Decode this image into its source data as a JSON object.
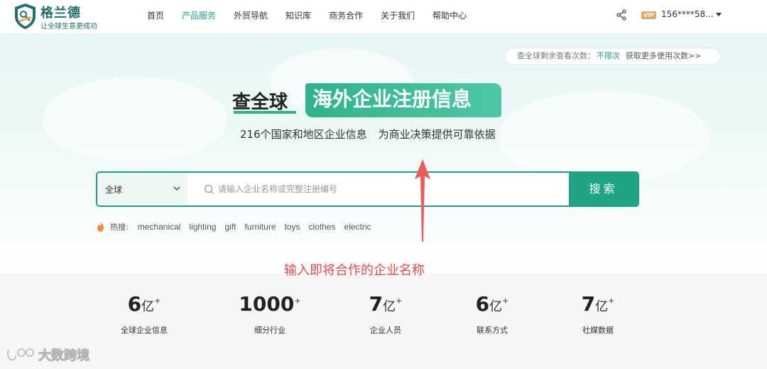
{
  "brand": {
    "name": "格兰德",
    "slogan": "让全球生意更成功",
    "color": "#1f6f70"
  },
  "nav": {
    "items": [
      {
        "label": "首页",
        "active": false
      },
      {
        "label": "产品服务",
        "active": true
      },
      {
        "label": "外贸导航",
        "active": false
      },
      {
        "label": "知识库",
        "active": false
      },
      {
        "label": "商务合作",
        "active": false
      },
      {
        "label": "关于我们",
        "active": false
      },
      {
        "label": "帮助中心",
        "active": false
      }
    ],
    "active_color": "#1aa382"
  },
  "user": {
    "share_icon": "share-icon",
    "vip_label": "VIP",
    "phone": "156****58..."
  },
  "quota": {
    "label": "查全球剩余查看次数：",
    "value": "不限次",
    "link": "获取更多使用次数>>"
  },
  "hero": {
    "headline_left": "查全球",
    "headline_right": "海外企业注册信息",
    "subtitle_part1": "216个国家和地区企业信息",
    "subtitle_part2": "为商业决策提供可靠依据"
  },
  "search": {
    "region": "全球",
    "placeholder": "请输入企业名称或完整注册编号",
    "value": "",
    "button_label": "搜索"
  },
  "hot": {
    "label": "热搜:",
    "items": [
      "mechanical",
      "lighting",
      "gift",
      "furniture",
      "toys",
      "clothes",
      "electric"
    ]
  },
  "annotation": {
    "text": "输入即将合作的企业名称",
    "color": "#e84a4a"
  },
  "stats": [
    {
      "number": "6",
      "unit": "亿",
      "sup": "+",
      "label": "全球企业信息"
    },
    {
      "number": "1000",
      "unit": "",
      "sup": "+",
      "label": "细分行业"
    },
    {
      "number": "7",
      "unit": "亿",
      "sup": "+",
      "label": "企业人员"
    },
    {
      "number": "6",
      "unit": "亿",
      "sup": "+",
      "label": "联系方式"
    },
    {
      "number": "7",
      "unit": "亿",
      "sup": "+",
      "label": "社媒数据"
    }
  ],
  "watermark": {
    "text": "大数跨境"
  }
}
